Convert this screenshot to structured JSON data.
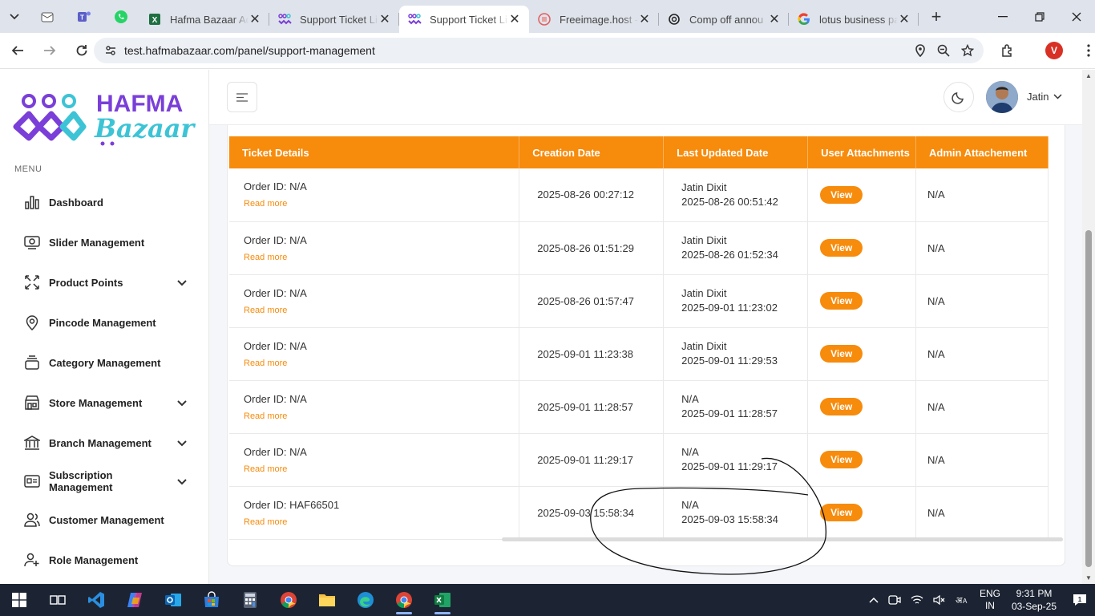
{
  "browser": {
    "tabs": [
      {
        "title": "Hafma Bazaar Ad",
        "favicon": "excel-icon",
        "active": false
      },
      {
        "title": "Support Ticket Li",
        "favicon": "hafma-icon",
        "active": false
      },
      {
        "title": "Support Ticket Li",
        "favicon": "hafma-icon",
        "active": true
      },
      {
        "title": "Freeimage.host -",
        "favicon": "freeimage-icon",
        "active": false
      },
      {
        "title": "Comp off annou",
        "favicon": "openai-icon",
        "active": false
      },
      {
        "title": "lotus business pa",
        "favicon": "google-icon",
        "active": false
      }
    ],
    "url": "test.hafmabazaar.com/panel/support-management",
    "profile_initial": "V"
  },
  "sidebar": {
    "brand_top": "HAFMA",
    "brand_bottom": "Bazaar",
    "menu_label": "MENU",
    "items": [
      {
        "label": "Dashboard",
        "icon": "bar-chart-icon",
        "has_submenu": false
      },
      {
        "label": "Slider Management",
        "icon": "image-slider-icon",
        "has_submenu": false
      },
      {
        "label": "Product Points",
        "icon": "arrows-icon",
        "has_submenu": true
      },
      {
        "label": "Pincode Management",
        "icon": "location-pin-icon",
        "has_submenu": false
      },
      {
        "label": "Category Management",
        "icon": "layers-icon",
        "has_submenu": false
      },
      {
        "label": "Store Management",
        "icon": "store-icon",
        "has_submenu": true
      },
      {
        "label": "Branch Management",
        "icon": "bank-icon",
        "has_submenu": true
      },
      {
        "label": "Subscription Management",
        "icon": "id-card-icon",
        "has_submenu": true
      },
      {
        "label": "Customer Management",
        "icon": "users-icon",
        "has_submenu": false
      },
      {
        "label": "Role Management",
        "icon": "user-add-icon",
        "has_submenu": false
      }
    ]
  },
  "header": {
    "user_name": "Jatin"
  },
  "table": {
    "columns": [
      "Ticket Details",
      "Creation Date",
      "Last Updated Date",
      "User Attachments",
      "Admin Attachement"
    ],
    "read_more_label": "Read more",
    "view_label": "View",
    "rows": [
      {
        "order": "Order ID: N/A",
        "created": "2025-08-26 00:27:12",
        "updated_by": "Jatin Dixit",
        "updated_at": "2025-08-26 00:51:42",
        "admin_attachment": "N/A"
      },
      {
        "order": "Order ID: N/A",
        "created": "2025-08-26 01:51:29",
        "updated_by": "Jatin Dixit",
        "updated_at": "2025-08-26 01:52:34",
        "admin_attachment": "N/A"
      },
      {
        "order": "Order ID: N/A",
        "created": "2025-08-26 01:57:47",
        "updated_by": "Jatin Dixit",
        "updated_at": "2025-09-01 11:23:02",
        "admin_attachment": "N/A"
      },
      {
        "order": "Order ID: N/A",
        "created": "2025-09-01 11:23:38",
        "updated_by": "Jatin Dixit",
        "updated_at": "2025-09-01 11:29:53",
        "admin_attachment": "N/A"
      },
      {
        "order": "Order ID: N/A",
        "created": "2025-09-01 11:28:57",
        "updated_by": "N/A",
        "updated_at": "2025-09-01 11:28:57",
        "admin_attachment": "N/A"
      },
      {
        "order": "Order ID: N/A",
        "created": "2025-09-01 11:29:17",
        "updated_by": "N/A",
        "updated_at": "2025-09-01 11:29:17",
        "admin_attachment": "N/A"
      },
      {
        "order": "Order ID: HAF66501",
        "created": "2025-09-03 15:58:34",
        "updated_by": "N/A",
        "updated_at": "2025-09-03 15:58:34",
        "admin_attachment": "N/A"
      }
    ]
  },
  "taskbar": {
    "lang_top": "ENG",
    "lang_bottom": "IN",
    "time": "9:31 PM",
    "date": "03-Sep-25"
  },
  "colors": {
    "accent": "#f78b0c",
    "brand_purple": "#7a3fd8",
    "brand_teal": "#3cc4d6"
  }
}
